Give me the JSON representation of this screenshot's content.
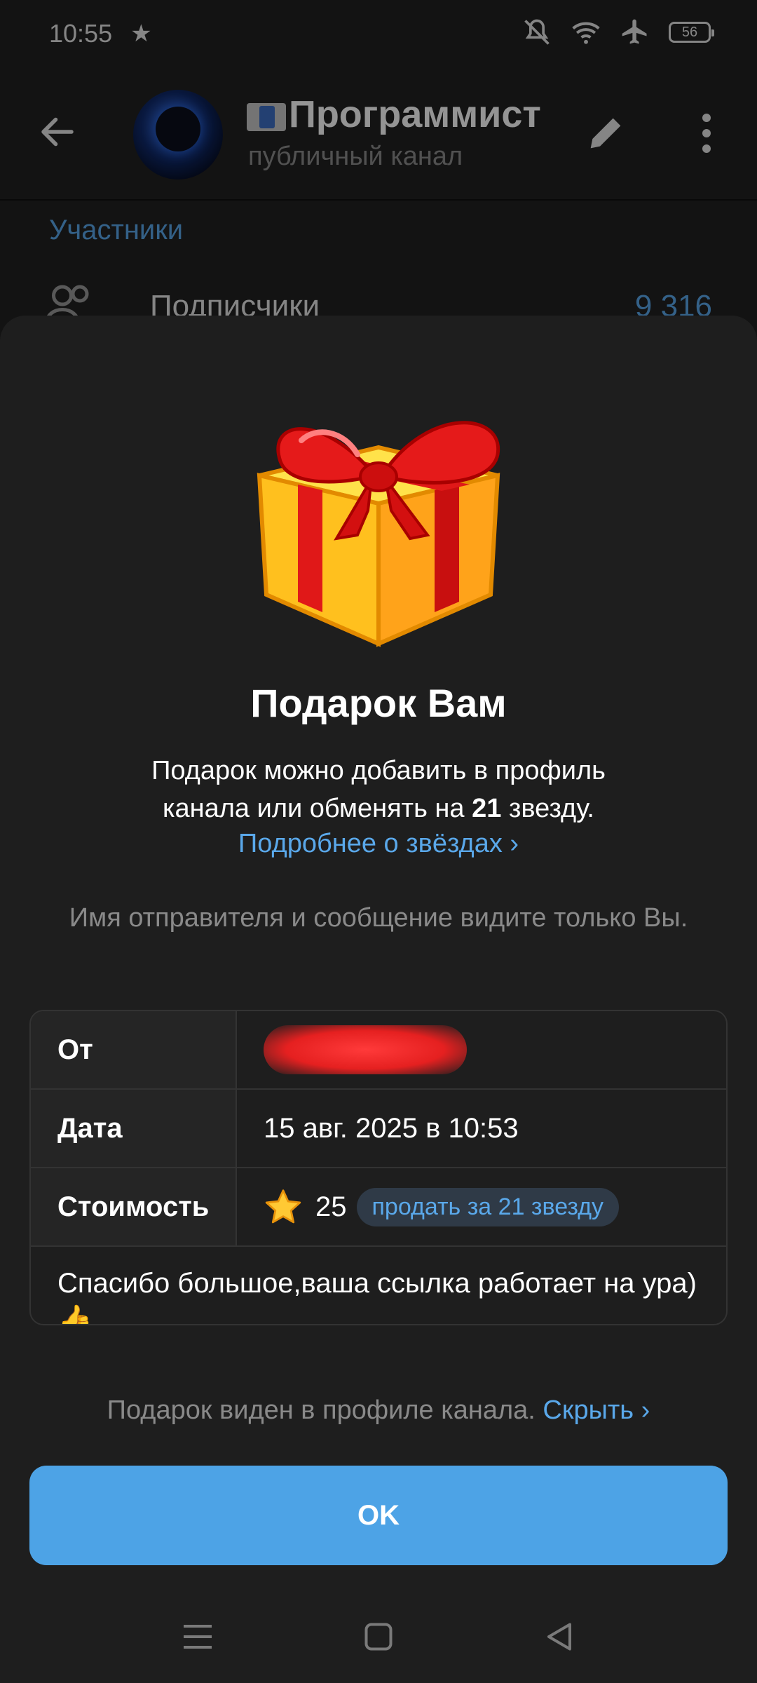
{
  "status_bar": {
    "time": "10:55",
    "battery": "56"
  },
  "header": {
    "channel_title": "Программист",
    "channel_title_icon": "envelope-emoji",
    "channel_subtitle": "публичный канал"
  },
  "info": {
    "section_label": "Участники",
    "members_label": "Подписчики",
    "members_count": "9 316"
  },
  "gift_sheet": {
    "title": "Подарок Вам",
    "description_line1": "Подарок можно добавить в профиль",
    "description_prefix": "канала или обменять на ",
    "description_bold": "21",
    "description_suffix": " звезду.",
    "stars_link": "Подробнее о звёздах ›",
    "privacy_note": "Имя отправителя и сообщение видите только Вы.",
    "table": {
      "from_label": "От",
      "date_label": "Дата",
      "date_value": "15 авг. 2025 в 10:53",
      "price_label": "Стоимость",
      "price_value": "25",
      "sell_label": "продать за 21 звезду",
      "message": "Спасибо большое,ваша ссылка работает на ура) 👍"
    },
    "visible_note": "Подарок виден в профиле канала. ",
    "hide_link": "Скрыть ›",
    "ok_button": "OK"
  },
  "colors": {
    "accent": "#5aa8ea",
    "button": "#4da3e6",
    "sheet_bg": "#1e1e1e",
    "redaction": "#e52020"
  }
}
